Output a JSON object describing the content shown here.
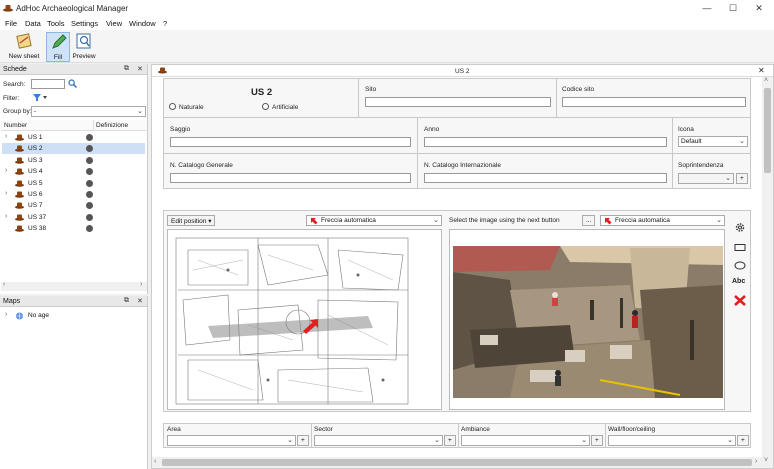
{
  "window": {
    "title": "AdHoc Archaeological Manager",
    "minimize": "—",
    "maximize": "☐",
    "close": "✕"
  },
  "menu": [
    "File",
    "Data",
    "Tools",
    "Settings",
    "View",
    "Window",
    "?"
  ],
  "toolbar": {
    "new_sheet": "New sheet",
    "fill": "Fill",
    "preview": "Preview"
  },
  "schede": {
    "title": "Schede",
    "search_label": "Search:",
    "search_value": "",
    "filter_label": "Filter:",
    "groupby_label": "Group by:",
    "groupby_value": "-",
    "col_number": "Number",
    "col_definition": "Definizione",
    "items": [
      {
        "label": "US 1",
        "expandable": true,
        "selected": false
      },
      {
        "label": "US 2",
        "expandable": false,
        "selected": true
      },
      {
        "label": "US 3",
        "expandable": false,
        "selected": false
      },
      {
        "label": "US 4",
        "expandable": true,
        "selected": false
      },
      {
        "label": "US 5",
        "expandable": false,
        "selected": false
      },
      {
        "label": "US 6",
        "expandable": true,
        "selected": false
      },
      {
        "label": "US 7",
        "expandable": false,
        "selected": false
      },
      {
        "label": "US 37",
        "expandable": true,
        "selected": false
      },
      {
        "label": "US 38",
        "expandable": false,
        "selected": false
      }
    ]
  },
  "maps": {
    "title": "Maps",
    "item": "No age"
  },
  "doc": {
    "tab_title": "US 2",
    "heading": "US 2",
    "radio_naturale": "Naturale",
    "radio_artificiale": "Artificiale",
    "sito": "Sito",
    "codice_sito": "Codice sito",
    "saggio": "Saggio",
    "anno": "Anno",
    "icona": "Icona",
    "icona_value": "Default",
    "cat_generale": "N. Catalogo Generale",
    "cat_internazionale": "N. Catalogo Internazionale",
    "soprintendenza": "Soprintendenza",
    "edit_position": "Edit position ▾",
    "freccia1": "Freccia automatica",
    "select_image": "Select the image using the next button",
    "browse": "...",
    "freccia2": "Freccia automatica",
    "abc": "Abc",
    "area": "Area",
    "sector": "Sector",
    "ambiance": "Ambiance",
    "wall": "Wall/floor/ceiling",
    "plus": "+"
  },
  "colors": {
    "accent": "#3a7fd5",
    "selection": "#cde0f5",
    "arrow_red": "#e02020"
  }
}
